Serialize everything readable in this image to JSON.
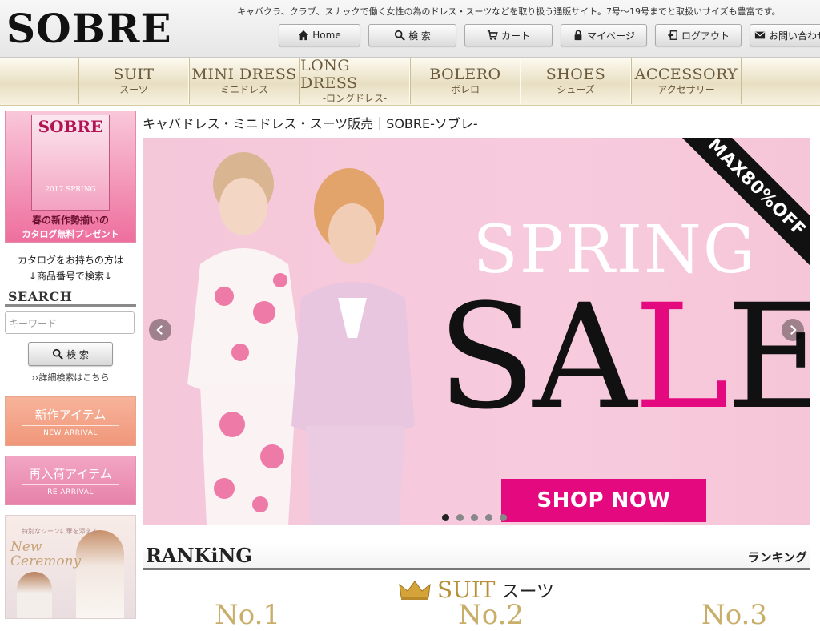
{
  "header": {
    "logo": "SOBRE",
    "tagline": "キャバクラ、クラブ、スナックで働く女性の為のドレス・スーツなどを取り扱う通販サイト。7号〜19号までと取扱いサイズも豊富です。",
    "nav": [
      {
        "label": "Home",
        "icon": "home-icon"
      },
      {
        "label": "検 索",
        "icon": "search-icon"
      },
      {
        "label": "カート",
        "icon": "cart-icon"
      },
      {
        "label": "マイページ",
        "icon": "lock-icon"
      },
      {
        "label": "ログアウト",
        "icon": "logout-icon"
      },
      {
        "label": "お問い合わせ",
        "icon": "mail-icon"
      }
    ]
  },
  "categories": [
    {
      "en": "SUIT",
      "jp": "-スーツ-"
    },
    {
      "en": "MINI DRESS",
      "jp": "-ミニドレス-"
    },
    {
      "en": "LONG DRESS",
      "jp": "-ロングドレス-"
    },
    {
      "en": "BOLERO",
      "jp": "-ボレロ-"
    },
    {
      "en": "SHOES",
      "jp": "-シューズ-"
    },
    {
      "en": "ACCESSORY",
      "jp": "-アクセサリー-"
    }
  ],
  "sidebar": {
    "catalog": {
      "logo": "SOBRE",
      "sub": "2017 SPRING",
      "caption1": "春の新作勢揃いの",
      "caption2": "カタログ無料プレゼント"
    },
    "catalog_note_1": "カタログをお持ちの方は",
    "catalog_note_2": "↓商品番号で検索↓",
    "search_heading": "SEARCH",
    "search_placeholder": "キーワード",
    "search_button": "検 索",
    "advanced_link": "››詳細検索はこちら",
    "new_arrival": {
      "jp": "新作アイテム",
      "en": "NEW ARRIVAL"
    },
    "re_arrival": {
      "jp": "再入荷アイテム",
      "en": "RE ARRIVAL"
    },
    "ceremony": {
      "small": "特別なシーンに華を添える",
      "line1": "New",
      "line2": "Ceremony"
    }
  },
  "main": {
    "page_title": "キャバドレス・ミニドレス・スーツ販売｜SOBRE-ソブレ-",
    "hero": {
      "ribbon": "MAX80%OFF",
      "spring": "SPRING",
      "sale_1": "SA",
      "sale_2": "L",
      "sale_3": "E",
      "cta": "SHOP NOW",
      "slide_count": 5,
      "active_slide": 1
    },
    "ranking": {
      "en": "RANKiNG",
      "jp": "ランキング"
    },
    "suit": {
      "en": "SUIT",
      "jp": "スーツ"
    },
    "ranks": [
      "No.1",
      "No.2",
      "No.3"
    ]
  },
  "colors": {
    "accent_pink": "#e5097f",
    "hero_bg": "#f7cbdd",
    "gold_text": "#b8903c"
  }
}
